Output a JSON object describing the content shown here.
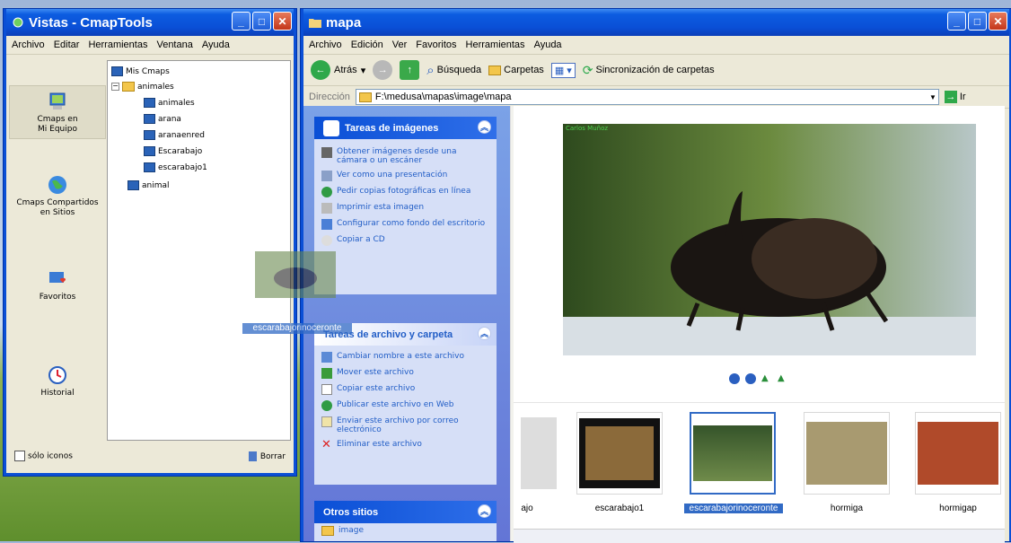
{
  "cmap": {
    "title": "Vistas - CmapTools",
    "menu": [
      "Archivo",
      "Editar",
      "Herramientas",
      "Ventana",
      "Ayuda"
    ],
    "side": [
      {
        "label1": "Cmaps en",
        "label2": "Mi Equipo"
      },
      {
        "label1": "Cmaps Compartidos",
        "label2": "en Sitios"
      },
      {
        "label1": "Favoritos",
        "label2": ""
      },
      {
        "label1": "Historial",
        "label2": ""
      }
    ],
    "tree": {
      "root": "Mis Cmaps",
      "folder": "animales",
      "items": [
        "animales",
        "arana",
        "aranaenred",
        "Escarabajo",
        "escarabajo1"
      ],
      "last": "animal"
    },
    "icons_only": "sólo iconos",
    "delete": "Borrar"
  },
  "explorer": {
    "title": "mapa",
    "menu": [
      "Archivo",
      "Edición",
      "Ver",
      "Favoritos",
      "Herramientas",
      "Ayuda"
    ],
    "back": "Atrás",
    "search": "Búsqueda",
    "folders": "Carpetas",
    "sync": "Sincronización de carpetas",
    "address_label": "Dirección",
    "address": "F:\\medusa\\mapas\\image\\mapa",
    "go": "Ir",
    "image_tasks": {
      "title": "Tareas de imágenes",
      "items": [
        "Obtener imágenes desde una cámara o un escáner",
        "Ver como una presentación",
        "Pedir copias fotográficas en línea",
        "Imprimir esta imagen",
        "Configurar como fondo del escritorio",
        "Copiar a CD"
      ]
    },
    "file_tasks": {
      "title": "Tareas de archivo y carpeta",
      "items": [
        "Cambiar nombre a este archivo",
        "Mover este archivo",
        "Copiar este archivo",
        "Publicar este archivo en Web",
        "Enviar este archivo por correo electrónico",
        "Eliminar este archivo"
      ]
    },
    "other": {
      "title": "Otros sitios",
      "items": [
        "image"
      ]
    },
    "photo_credit": "Carlos Muñoz",
    "thumbs": [
      "ajo",
      "escarabajo1",
      "escarabajorinoceronte",
      "hormiga",
      "hormigap"
    ]
  },
  "drag_label": "escarabajorinoceronte",
  "colors": {
    "title_blue": "#0a4fd6",
    "task_link": "#215dc6",
    "selection": "#316ac5"
  }
}
